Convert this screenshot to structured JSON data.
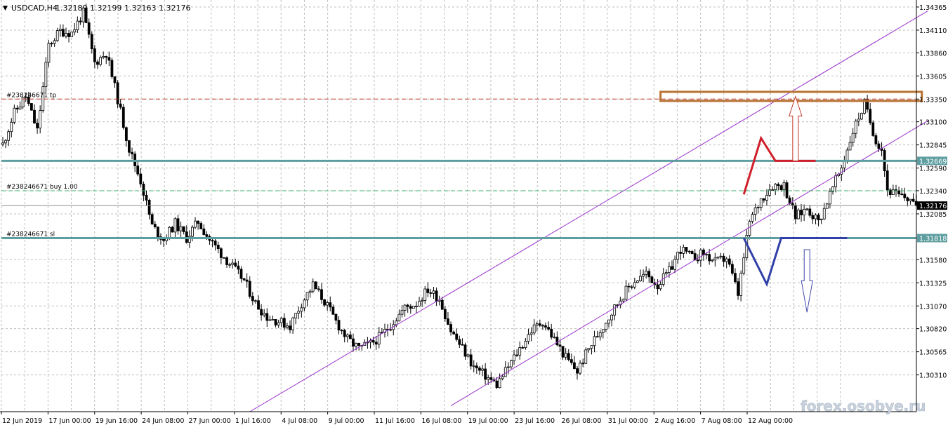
{
  "header": {
    "menu_glyph": "▼",
    "symbol_label": "USDCAD,H4",
    "ohlc": "1.32189 1.32199 1.32163 1.32176"
  },
  "watermark": "forex.osobye.ru",
  "colors": {
    "background": "#ffffff",
    "grid": "#bfbfbf",
    "candle": "#000000",
    "level_line": "#5f9ea0",
    "channel": "#9932cc",
    "tp_line": "#c0392b",
    "buy_line": "#3cb371",
    "zone": "#b87333",
    "up_arrow": "#c0392b",
    "down_arrow": "#3f48a8",
    "up_zigzag": "#d11f2a",
    "down_zigzag": "#3140a8",
    "price_tag_bg": "#5f9ea0",
    "current_tag_bg": "#000000"
  },
  "chart_data": {
    "type": "candlestick",
    "symbol": "USDCAD",
    "timeframe": "H4",
    "y_range": [
      1.29905,
      1.34442
    ],
    "y_ticks": [
      "1.34365",
      "1.34110",
      "1.33860",
      "1.33605",
      "1.33350",
      "1.33100",
      "1.32845",
      "1.32590",
      "1.32340",
      "1.32085",
      "1.31580",
      "1.31325",
      "1.31070",
      "1.30820",
      "1.30565",
      "1.30310"
    ],
    "x_ticks": [
      "12 Jun 2019",
      "17 Jun 00:00",
      "19 Jun 16:00",
      "24 Jun 08:00",
      "27 Jun 00:00",
      "1 Jul 16:00",
      "4 Jul 08:00",
      "9 Jul 00:00",
      "11 Jul 16:00",
      "16 Jul 08:00",
      "19 Jul 00:00",
      "23 Jul 16:00",
      "26 Jul 08:00",
      "31 Jul 00:00",
      "2 Aug 16:00",
      "7 Aug 08:00",
      "12 Aug 00:00"
    ],
    "grid": true,
    "close_path": [
      [
        0,
        1.3285
      ],
      [
        4,
        1.332
      ],
      [
        8,
        1.3338
      ],
      [
        12,
        1.33
      ],
      [
        16,
        1.3395
      ],
      [
        20,
        1.341
      ],
      [
        24,
        1.3408
      ],
      [
        28,
        1.343
      ],
      [
        32,
        1.3375
      ],
      [
        36,
        1.3386
      ],
      [
        40,
        1.3335
      ],
      [
        44,
        1.328
      ],
      [
        48,
        1.3245
      ],
      [
        52,
        1.3195
      ],
      [
        56,
        1.318
      ],
      [
        60,
        1.3198
      ],
      [
        64,
        1.3182
      ],
      [
        68,
        1.32
      ],
      [
        72,
        1.318
      ],
      [
        76,
        1.3165
      ],
      [
        80,
        1.315
      ],
      [
        84,
        1.3135
      ],
      [
        88,
        1.311
      ],
      [
        92,
        1.3095
      ],
      [
        96,
        1.309
      ],
      [
        100,
        1.3085
      ],
      [
        104,
        1.311
      ],
      [
        108,
        1.313
      ],
      [
        112,
        1.3112
      ],
      [
        116,
        1.309
      ],
      [
        120,
        1.307
      ],
      [
        124,
        1.306
      ],
      [
        128,
        1.3065
      ],
      [
        132,
        1.3075
      ],
      [
        136,
        1.309
      ],
      [
        140,
        1.3105
      ],
      [
        144,
        1.311
      ],
      [
        148,
        1.3125
      ],
      [
        152,
        1.3115
      ],
      [
        156,
        1.308
      ],
      [
        160,
        1.306
      ],
      [
        164,
        1.304
      ],
      [
        168,
        1.303
      ],
      [
        172,
        1.302
      ],
      [
        176,
        1.304
      ],
      [
        180,
        1.306
      ],
      [
        184,
        1.308
      ],
      [
        188,
        1.309
      ],
      [
        192,
        1.307
      ],
      [
        196,
        1.305
      ],
      [
        200,
        1.3035
      ],
      [
        204,
        1.306
      ],
      [
        208,
        1.308
      ],
      [
        212,
        1.31
      ],
      [
        216,
        1.312
      ],
      [
        220,
        1.3135
      ],
      [
        224,
        1.3142
      ],
      [
        228,
        1.313
      ],
      [
        232,
        1.3145
      ],
      [
        236,
        1.317
      ],
      [
        240,
        1.316
      ],
      [
        244,
        1.3165
      ],
      [
        248,
        1.3155
      ],
      [
        252,
        1.316
      ],
      [
        256,
        1.312
      ],
      [
        260,
        1.32
      ],
      [
        264,
        1.3225
      ],
      [
        268,
        1.324
      ],
      [
        272,
        1.324
      ],
      [
        276,
        1.3205
      ],
      [
        280,
        1.3215
      ],
      [
        284,
        1.32
      ],
      [
        288,
        1.323
      ],
      [
        292,
        1.326
      ],
      [
        296,
        1.33
      ],
      [
        300,
        1.333
      ],
      [
        304,
        1.329
      ],
      [
        306,
        1.328
      ],
      [
        308,
        1.3235
      ],
      [
        312,
        1.3228
      ],
      [
        316,
        1.3225
      ],
      [
        318,
        1.3218
      ]
    ],
    "last_close": 1.32176,
    "horizontal_levels": [
      {
        "price": 1.32669,
        "label": "1.32669",
        "color": "#5f9ea0"
      },
      {
        "price": 1.31818,
        "label": "1.31818",
        "color": "#5f9ea0"
      }
    ],
    "current_price": {
      "price": 1.32176,
      "label": "1.32176"
    },
    "order_lines": [
      {
        "label": "#238246671 tp",
        "price": 1.3335,
        "style": "dashed",
        "color": "#c0392b"
      },
      {
        "label": "#238246671 buy 1.00",
        "price": 1.3234,
        "style": "dashed",
        "color": "#3cb371"
      },
      {
        "label": "#238246671 sl",
        "price": 1.31818,
        "style": "dashed",
        "color": "#5f9ea0"
      }
    ],
    "channel_lines": [
      {
        "from": [
          86,
          1.29905
        ],
        "to": [
          322,
          1.3432
        ]
      },
      {
        "from": [
          156,
          1.2997
        ],
        "to": [
          322,
          1.3311
        ]
      }
    ],
    "resistance_zone": {
      "from_bar": 229,
      "to_bar": 320,
      "price_top": 1.3343,
      "price_bottom": 1.3333
    },
    "projections": {
      "up_zigzag": [
        [
          258,
          1.323
        ],
        [
          264,
          1.3292
        ],
        [
          269,
          1.32669
        ],
        [
          283,
          1.32669
        ]
      ],
      "down_zigzag": [
        [
          258,
          1.31818
        ],
        [
          266,
          1.3131
        ],
        [
          271,
          1.31818
        ],
        [
          294,
          1.31818
        ]
      ],
      "up_arrow": {
        "bar": 276,
        "from": 1.32669,
        "to": 1.3338
      },
      "down_arrow": {
        "bar": 280,
        "from": 1.3169,
        "to": 1.31
      }
    }
  }
}
